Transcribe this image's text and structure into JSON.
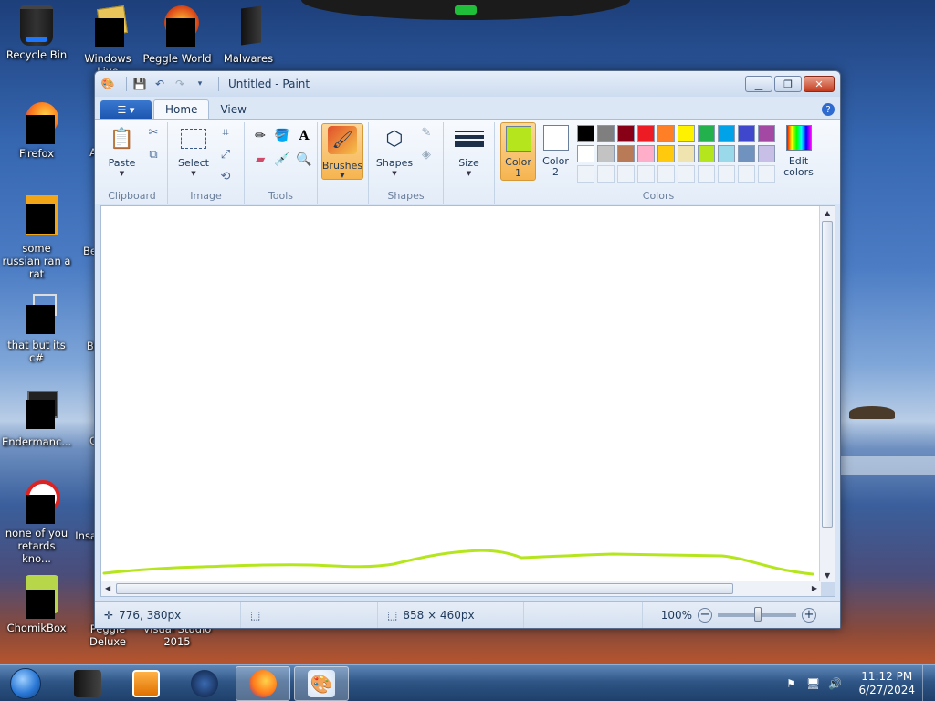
{
  "desktop": {
    "icons": [
      {
        "label": "Recycle Bin"
      },
      {
        "label": "Windows Live"
      },
      {
        "label": "Peggle World"
      },
      {
        "label": "Malwares"
      },
      {
        "label": "Firefox"
      },
      {
        "label": "some russian ran a rat"
      },
      {
        "label": "that but its c#"
      },
      {
        "label": "Endermanc..."
      },
      {
        "label": "none of you retards kno..."
      },
      {
        "label": "ChomikBox"
      },
      {
        "label": "Peggle Deluxe"
      },
      {
        "label": "Visual Studio 2015"
      }
    ],
    "partial_labels": [
      "A",
      "Be",
      "Bi",
      "C",
      "Insa"
    ]
  },
  "window": {
    "title": "Untitled - Paint",
    "tabs": [
      "Home",
      "View"
    ],
    "ribbon": {
      "clipboard": {
        "paste_label": "Paste",
        "group_label": "Clipboard"
      },
      "image": {
        "select_label": "Select",
        "group_label": "Image"
      },
      "tools": {
        "group_label": "Tools"
      },
      "brushes_label": "Brushes",
      "shapes": {
        "shapes_label": "Shapes",
        "group_label": "Shapes"
      },
      "size_label": "Size",
      "colors": {
        "color1_label": "Color 1",
        "color2_label": "Color 2",
        "edit_colors_label": "Edit colors",
        "group_label": "Colors",
        "color1": "#b5e61d",
        "color2": "#ffffff",
        "palette_row1": [
          "#000000",
          "#7f7f7f",
          "#880015",
          "#ed1c24",
          "#ff7f27",
          "#fff200",
          "#22b14c",
          "#00a2e8",
          "#3f48cc",
          "#a349a4"
        ],
        "palette_row2": [
          "#ffffff",
          "#c3c3c3",
          "#b97a57",
          "#ffaec9",
          "#ffc90e",
          "#efe4b0",
          "#b5e61d",
          "#99d9ea",
          "#7092be",
          "#c8bfe7"
        ]
      }
    },
    "canvas": {
      "stroke_color": "#b5e61d"
    },
    "status": {
      "cursor_pos": "776, 380px",
      "canvas_size": "858 × 460px",
      "zoom": "100%"
    }
  },
  "taskbar": {
    "time": "11:12 PM",
    "date": "6/27/2024"
  }
}
